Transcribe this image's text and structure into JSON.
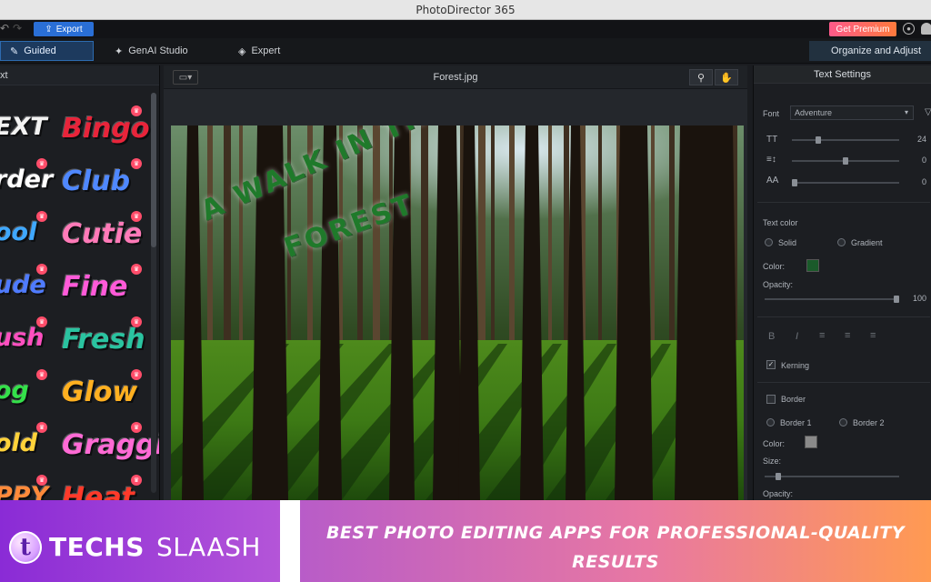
{
  "app": {
    "title": "PhotoDirector 365"
  },
  "toolbar": {
    "export_label": "Export",
    "premium_label": "Get Premium"
  },
  "modes": {
    "guided": "Guided",
    "genai": "GenAI Studio",
    "expert": "Expert",
    "organize": "Organize and Adjust"
  },
  "left_panel": {
    "header": "xt",
    "styles": [
      {
        "text": "EXT",
        "color": "#f2f2f2"
      },
      {
        "text": "Bingo",
        "color": "#e8243a"
      },
      {
        "text": "rder",
        "color": "#ffffff"
      },
      {
        "text": "Club",
        "color": "#4f88ff"
      },
      {
        "text": "ool",
        "color": "#3fa8ff"
      },
      {
        "text": "Cutie",
        "color": "#ff7ab8"
      },
      {
        "text": "ude",
        "color": "#4f7bff"
      },
      {
        "text": "Fine",
        "color": "#ff5ad8"
      },
      {
        "text": "ush",
        "color": "#ff4fc0"
      },
      {
        "text": "Fresh",
        "color": "#2ac3a0"
      },
      {
        "text": "og",
        "color": "#34e04a"
      },
      {
        "text": "Glow",
        "color": "#ffb020"
      },
      {
        "text": "old",
        "color": "#ffd23a"
      },
      {
        "text": "Graggiti",
        "color": "#ff6ad5"
      },
      {
        "text": "PPY",
        "color": "#ff8a3a"
      },
      {
        "text": "Heat",
        "color": "#ff3a2a"
      }
    ]
  },
  "canvas": {
    "file_name": "Forest.jpg",
    "overlay_line1": "A WALK IN THE",
    "overlay_line2": "FOREST",
    "text_color": "#1f7a2a"
  },
  "text_settings": {
    "title": "Text Settings",
    "font_label": "Font",
    "font_value": "Adventure",
    "size_value": "24",
    "line_spacing_value": "0",
    "char_spacing_value": "0",
    "text_color_label": "Text color",
    "solid_label": "Solid",
    "gradient_label": "Gradient",
    "color_label": "Color:",
    "opacity_label": "Opacity:",
    "opacity_value": "100",
    "kerning_label": "Kerning",
    "border_label": "Border",
    "border1_label": "Border 1",
    "border2_label": "Border 2",
    "border_color_label": "Color:",
    "size_label": "Size:",
    "border_opacity_label": "Opacity:",
    "text_swatch": "#1a5a2a",
    "border_swatch": "#8a8a8a"
  },
  "banner": {
    "brand_techs": "TECHS",
    "brand_slaash": "SLAASH",
    "logo_letter": "t",
    "headline_line1": "BEST PHOTO EDITING APPS FOR PROFESSIONAL-QUALITY",
    "headline_line2": "RESULTS"
  }
}
